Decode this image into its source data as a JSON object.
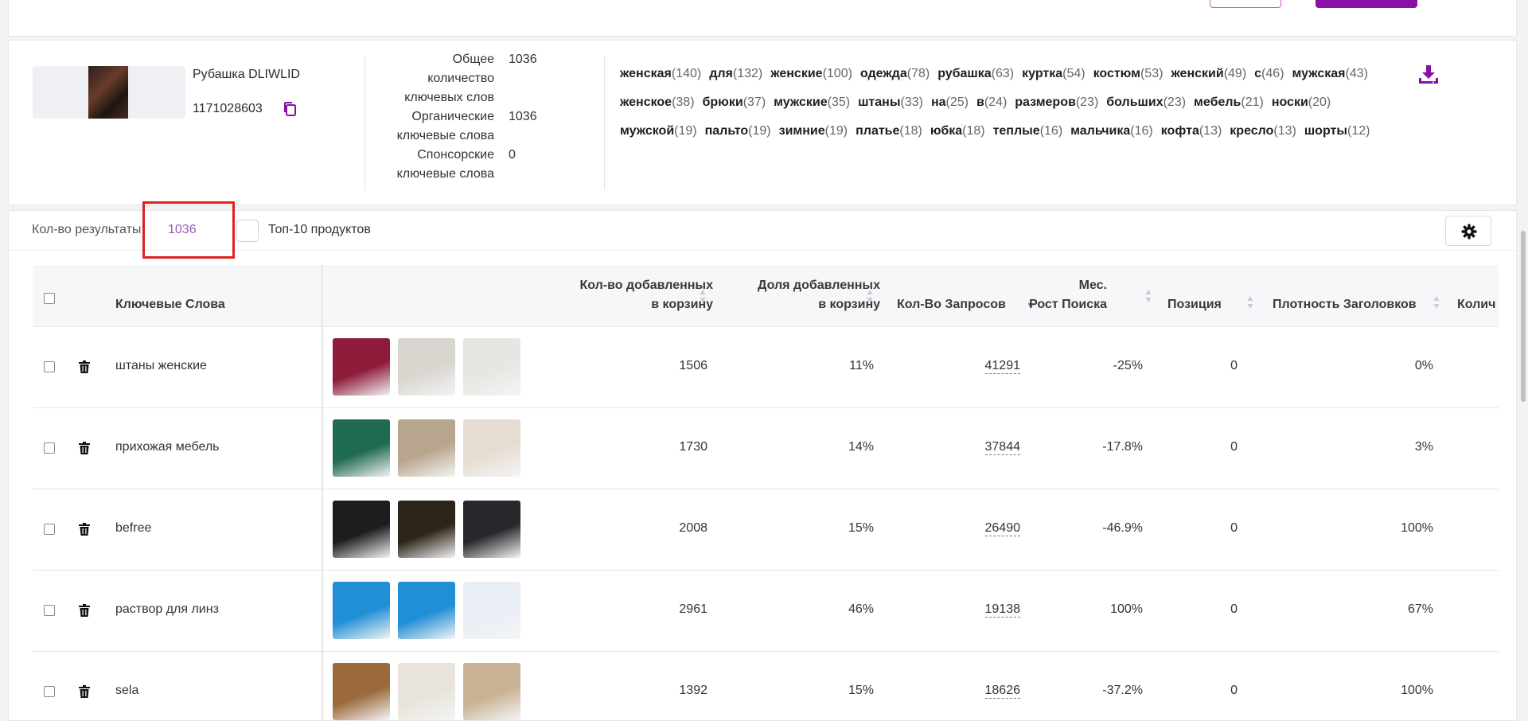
{
  "product": {
    "name": "Рубашка DLIWLID",
    "id": "1171028603"
  },
  "stats": [
    {
      "label_lines": [
        "Общее",
        "количество",
        "ключевых слов"
      ],
      "value": "1036"
    },
    {
      "label_lines": [
        "Органические",
        "ключевые слова"
      ],
      "value": "1036"
    },
    {
      "label_lines": [
        "Спонсорские",
        "ключевые слова"
      ],
      "value": "0"
    }
  ],
  "keyword_cloud": [
    {
      "word": "женская",
      "count": "(140)"
    },
    {
      "word": "для",
      "count": "(132)"
    },
    {
      "word": "женские",
      "count": "(100)"
    },
    {
      "word": "одежда",
      "count": "(78)"
    },
    {
      "word": "рубашка",
      "count": "(63)"
    },
    {
      "word": "куртка",
      "count": "(54)"
    },
    {
      "word": "костюм",
      "count": "(53)"
    },
    {
      "word": "женский",
      "count": "(49)"
    },
    {
      "word": "с",
      "count": "(46)"
    },
    {
      "word": "мужская",
      "count": "(43)"
    },
    {
      "word": "женское",
      "count": "(38)"
    },
    {
      "word": "брюки",
      "count": "(37)"
    },
    {
      "word": "мужские",
      "count": "(35)"
    },
    {
      "word": "штаны",
      "count": "(33)"
    },
    {
      "word": "на",
      "count": "(25)"
    },
    {
      "word": "в",
      "count": "(24)"
    },
    {
      "word": "размеров",
      "count": "(23)"
    },
    {
      "word": "больших",
      "count": "(23)"
    },
    {
      "word": "мебель",
      "count": "(21)"
    },
    {
      "word": "носки",
      "count": "(20)"
    },
    {
      "word": "мужской",
      "count": "(19)"
    },
    {
      "word": "пальто",
      "count": "(19)"
    },
    {
      "word": "зимние",
      "count": "(19)"
    },
    {
      "word": "платье",
      "count": "(18)"
    },
    {
      "word": "юбка",
      "count": "(18)"
    },
    {
      "word": "теплые",
      "count": "(16)"
    },
    {
      "word": "мальчика",
      "count": "(16)"
    },
    {
      "word": "кофта",
      "count": "(13)"
    },
    {
      "word": "кресло",
      "count": "(13)"
    },
    {
      "word": "шорты",
      "count": "(12)"
    }
  ],
  "toolbar": {
    "result_label": "Кол-во результаты:",
    "result_value": "1036",
    "top10_label": "Топ-10 продуктов"
  },
  "table": {
    "headers": {
      "keywords": "Ключевые Слова",
      "cart_count_l1": "Кол-во добавленных",
      "cart_count_l2": "в корзину",
      "cart_share_l1": "Доля добавленных",
      "cart_share_l2": "в корзину",
      "requests": "Кол-Во Запросов",
      "growth_l1": "Мес.",
      "growth_l2": "Рост Поиска",
      "position": "Позиция",
      "title_density": "Плотность Заголовков",
      "more": "Колич"
    },
    "rows": [
      {
        "keyword": "штаны женские",
        "cart_count": "1506",
        "cart_share": "11%",
        "requests": "41291",
        "growth": "-25%",
        "position": "0",
        "density": "0%",
        "thumbs": [
          "#8e1b3a",
          "#d9d6d0",
          "#e8e6e2"
        ]
      },
      {
        "keyword": "прихожая мебель",
        "cart_count": "1730",
        "cart_share": "14%",
        "requests": "37844",
        "growth": "-17.8%",
        "position": "0",
        "density": "3%",
        "thumbs": [
          "#1f6b4f",
          "#b8a58e",
          "#e6ddd2"
        ]
      },
      {
        "keyword": "befree",
        "cart_count": "2008",
        "cart_share": "15%",
        "requests": "26490",
        "growth": "-46.9%",
        "position": "0",
        "density": "100%",
        "thumbs": [
          "#1d1d1f",
          "#2e2519",
          "#27282b"
        ]
      },
      {
        "keyword": "раствор для линз",
        "cart_count": "2961",
        "cart_share": "46%",
        "requests": "19138",
        "growth": "100%",
        "position": "0",
        "density": "67%",
        "thumbs": [
          "#1f8fd6",
          "#1f8fd6",
          "#e9eef5"
        ]
      },
      {
        "keyword": "sela",
        "cart_count": "1392",
        "cart_share": "15%",
        "requests": "18626",
        "growth": "-37.2%",
        "position": "0",
        "density": "100%",
        "thumbs": [
          "#9a6a3c",
          "#e8e4dc",
          "#c9b294"
        ]
      }
    ]
  },
  "colors": {
    "accent": "#8a0fa6",
    "result_value": "#9b59b6",
    "highlight_box": "#e02020"
  }
}
